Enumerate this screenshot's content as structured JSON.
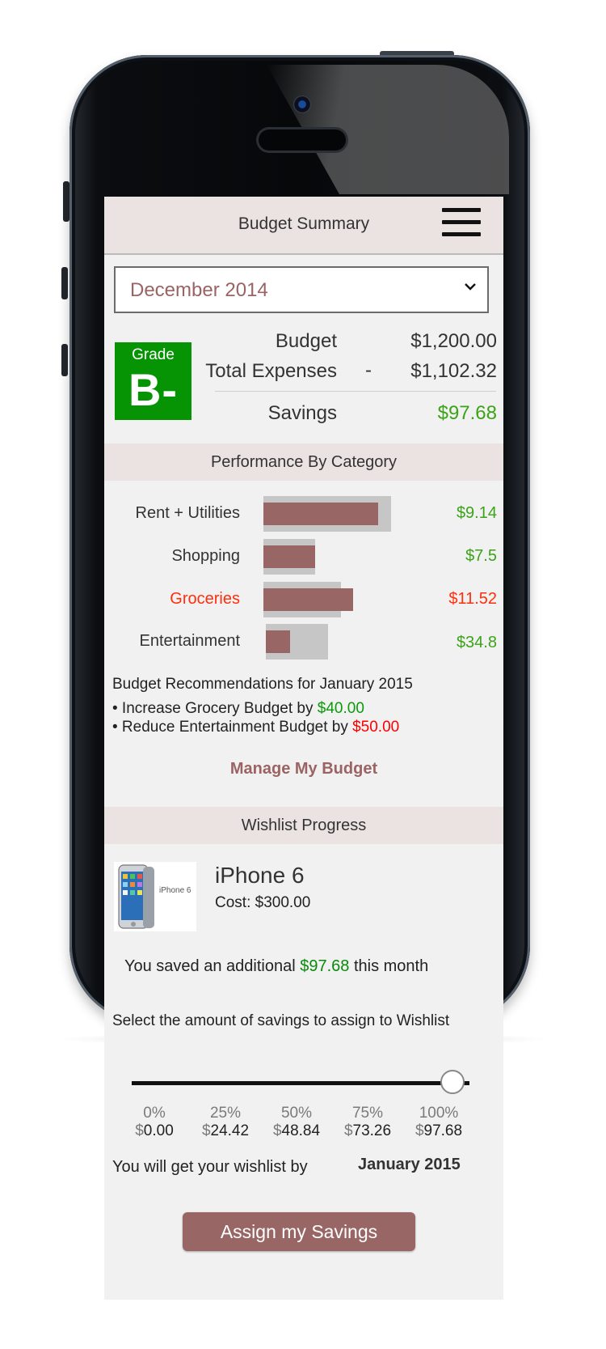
{
  "header": {
    "title": "Budget Summary",
    "menu_icon": "hamburger-menu-icon"
  },
  "month_select": {
    "selected": "December 2014"
  },
  "summary": {
    "grade_label": "Grade",
    "grade": "B-",
    "budget_label": "Budget",
    "budget_value": "$1,200.00",
    "expenses_label": "Total Expenses",
    "expenses_sign": "-",
    "expenses_value": "$1,102.32",
    "savings_label": "Savings",
    "savings_value": "$97.68"
  },
  "performance": {
    "title": "Performance By Category",
    "categories": [
      {
        "label": "Rent + Utilities",
        "value": "$9.14",
        "status": "under",
        "budget_ratio": 0.97,
        "spent_ratio": 0.88
      },
      {
        "label": "Shopping",
        "value": "$7.5",
        "status": "under",
        "budget_ratio": 0.4,
        "spent_ratio": 0.4
      },
      {
        "label": "Groceries",
        "value": "$11.52",
        "status": "over",
        "budget_ratio": 0.59,
        "spent_ratio": 0.68
      },
      {
        "label": "Entertainment",
        "value": "$34.8",
        "status": "under",
        "budget_ratio": 0.47,
        "spent_ratio": 0.18
      }
    ]
  },
  "recommendations": {
    "title": "Budget Recommendations for January 2015",
    "items": [
      {
        "prefix": "• Increase Grocery Budget by ",
        "amount": "$40.00",
        "color": "#0a9a0a"
      },
      {
        "prefix": "• Reduce Entertainment Budget by ",
        "amount": "$50.00",
        "color": "#ff0000"
      }
    ],
    "manage_link": "Manage My Budget"
  },
  "wishlist": {
    "title": "Wishlist Progress",
    "item_name": "iPhone 6",
    "item_cost": "Cost: $300.00",
    "thumbnail_text": "iPhone 6",
    "saved_prefix": "You saved an additional ",
    "saved_amount": "$97.68",
    "saved_suffix": " this month",
    "assign_prompt": "Select the amount of savings to assign to Wishlist",
    "slider_value_percent": 100,
    "ticks": [
      {
        "pct": "0%",
        "cur": "$",
        "amt": "0.00"
      },
      {
        "pct": "25%",
        "cur": "$",
        "amt": "24.42"
      },
      {
        "pct": "50%",
        "cur": "$",
        "amt": "48.84"
      },
      {
        "pct": "75%",
        "cur": "$",
        "amt": "73.26"
      },
      {
        "pct": "100%",
        "cur": "$",
        "amt": "97.68"
      }
    ],
    "eta_label": "You will get your wishlist by",
    "eta_value": "January 2015",
    "assign_button": "Assign my Savings"
  },
  "colors": {
    "accent": "#996666",
    "grade_green": "#069404",
    "positive": "#3ba317",
    "negative": "#ff2e0c",
    "section_bg": "#eae3e1"
  }
}
